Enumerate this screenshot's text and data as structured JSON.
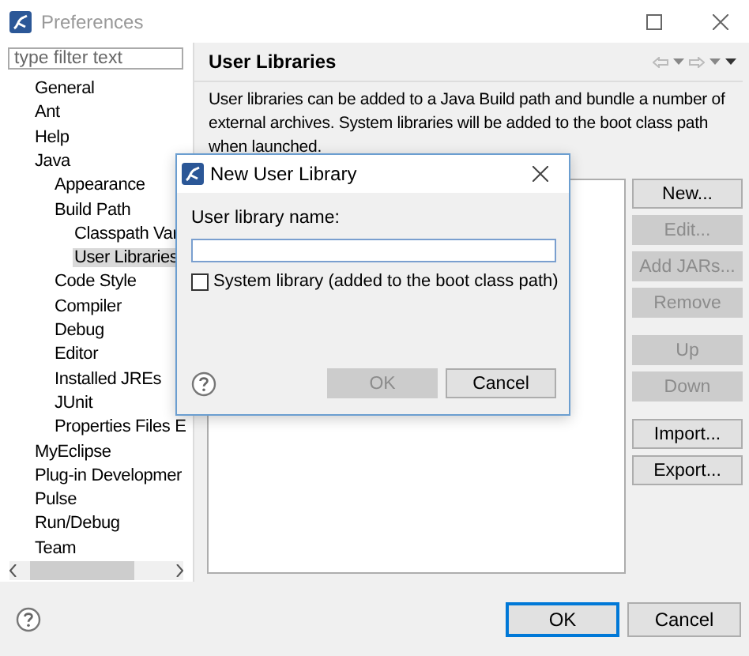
{
  "window": {
    "title": "Preferences"
  },
  "filter": {
    "placeholder": "type filter text"
  },
  "tree": [
    {
      "label": "General",
      "selected": false
    },
    {
      "label": "Ant",
      "selected": false
    },
    {
      "label": "Help",
      "selected": false
    },
    {
      "label": "Java",
      "selected": false,
      "children": [
        {
          "label": "Appearance",
          "selected": false
        },
        {
          "label": "Build Path",
          "selected": false,
          "children": [
            {
              "label": "Classpath Var",
              "selected": false
            },
            {
              "label": "User Libraries",
              "selected": true
            }
          ]
        },
        {
          "label": "Code Style",
          "selected": false
        },
        {
          "label": "Compiler",
          "selected": false
        },
        {
          "label": "Debug",
          "selected": false
        },
        {
          "label": "Editor",
          "selected": false
        },
        {
          "label": "Installed JREs",
          "selected": false
        },
        {
          "label": "JUnit",
          "selected": false
        },
        {
          "label": "Properties Files E",
          "selected": false
        }
      ]
    },
    {
      "label": "MyEclipse",
      "selected": false
    },
    {
      "label": "Plug-in Developmer",
      "selected": false
    },
    {
      "label": "Pulse",
      "selected": false
    },
    {
      "label": "Run/Debug",
      "selected": false
    },
    {
      "label": "Team",
      "selected": false
    }
  ],
  "page": {
    "title": "User Libraries",
    "description": "User libraries can be added to a Java Build path and bundle a number of external archives. System libraries will be added to the boot class path when launched.",
    "button_groups": [
      [
        {
          "label": "New...",
          "disabled": false
        },
        {
          "label": "Edit...",
          "disabled": true
        },
        {
          "label": "Add JARs...",
          "disabled": true
        },
        {
          "label": "Remove",
          "disabled": true
        }
      ],
      [
        {
          "label": "Up",
          "disabled": true
        },
        {
          "label": "Down",
          "disabled": true
        }
      ],
      [
        {
          "label": "Import...",
          "disabled": false
        },
        {
          "label": "Export...",
          "disabled": false
        }
      ]
    ]
  },
  "footer": {
    "buttons": [
      {
        "label": "OK",
        "default": true
      },
      {
        "label": "Cancel",
        "default": false
      }
    ]
  },
  "dialog": {
    "title": "New User Library",
    "field_label": "User library name:",
    "checkbox": {
      "label": "System library (added to the boot class path)",
      "checked": false
    },
    "buttons": [
      {
        "label": "OK",
        "disabled": true
      },
      {
        "label": "Cancel",
        "disabled": false
      }
    ]
  }
}
